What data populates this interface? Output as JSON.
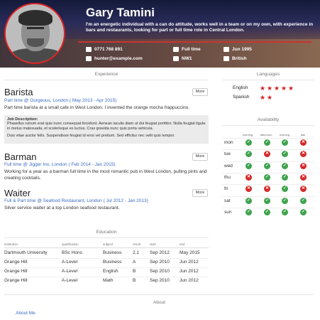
{
  "profile": {
    "name": "Gary Tamini",
    "bio": "I'm an energetic individual with a can do attitude, works well in a team or on my own, with experience in bars and restaurants, looking for part or full time role in Central London.",
    "phone": "0771 768 891",
    "email": "hunter@example.com",
    "availability_type": "Full time",
    "postcode": "NW1",
    "dob": "Jun 1995",
    "nationality": "British"
  },
  "sections": {
    "experience": "Experience",
    "languages": "Languages",
    "availability": "Availability",
    "education": "Education",
    "about": "About"
  },
  "experience": [
    {
      "title": "Barista",
      "sub": "Part time @ Gorgeous, London ( May 2013 - Apr 2015)",
      "desc": "Part time barista at a small cafe in West London. I invented the orange mocha frappuccino.",
      "more": "More",
      "detail_title": "Job Description:",
      "detail_p1": "Phasellus rutrum erat quis nunc consequat tincidunt. Aenean iaculis diam ut dui feugiat porttitor. Nulla feugiat ligula in metus malesuada, et scelerisque ex luctus. Cras gravida nunc quis porta vehicula.",
      "detail_p2": "Duis vitae auctor felis. Suspendisse feugiat id eros vel pretium. Sed efficitur nec velit quis tempor."
    },
    {
      "title": "Barman",
      "sub": "Full time @ Jigger Inn, London ( Feb 2014 - Jan 2015)",
      "desc": "Working for a year as a barman full time in the most romantic pub in West London, pulling pints and creating cocktails.",
      "more": "More"
    },
    {
      "title": "Waiter",
      "sub": "Full & Part time @ Seafood Restaurant, London ( Jul 2012 - Jan 2013)",
      "desc": "Silver service waiter at a top London seafood restaurant.",
      "more": "More"
    }
  ],
  "languages": [
    {
      "name": "English",
      "stars": 5
    },
    {
      "name": "Spanish",
      "stars": 2
    }
  ],
  "availability": {
    "headers": [
      "morning",
      "afternoon",
      "evening",
      "late"
    ],
    "rows": [
      {
        "day": "mon",
        "v": [
          true,
          true,
          true,
          false
        ]
      },
      {
        "day": "tue",
        "v": [
          true,
          false,
          true,
          false
        ]
      },
      {
        "day": "wed",
        "v": [
          true,
          true,
          true,
          false
        ]
      },
      {
        "day": "thu",
        "v": [
          false,
          true,
          true,
          false
        ]
      },
      {
        "day": "fri",
        "v": [
          false,
          false,
          true,
          false
        ]
      },
      {
        "day": "sat",
        "v": [
          true,
          true,
          true,
          true
        ]
      },
      {
        "day": "sun",
        "v": [
          true,
          true,
          true,
          true
        ]
      }
    ]
  },
  "education": {
    "headers": [
      "institution",
      "qualification",
      "subject",
      "result",
      "start",
      "end"
    ],
    "rows": [
      [
        "Dartmouth University",
        "BSc Hons",
        "Business",
        "2,1",
        "Sep 2012",
        "May 2015"
      ],
      [
        "Grange Hill",
        "A-Level",
        "Business",
        "A",
        "Sep 2010",
        "Jun 2012"
      ],
      [
        "Grange Hill",
        "A-Level",
        "English",
        "B",
        "Sep 2010",
        "Jun 2012"
      ],
      [
        "Grange Hill",
        "A-Level",
        "Math",
        "B",
        "Sep 2010",
        "Jun 2012"
      ]
    ]
  },
  "about": {
    "link": "About Me"
  },
  "colors": {
    "accent": "#d21f1f",
    "link": "#3a6bbf",
    "yes": "#3fa34d",
    "no": "#d42a2a"
  }
}
